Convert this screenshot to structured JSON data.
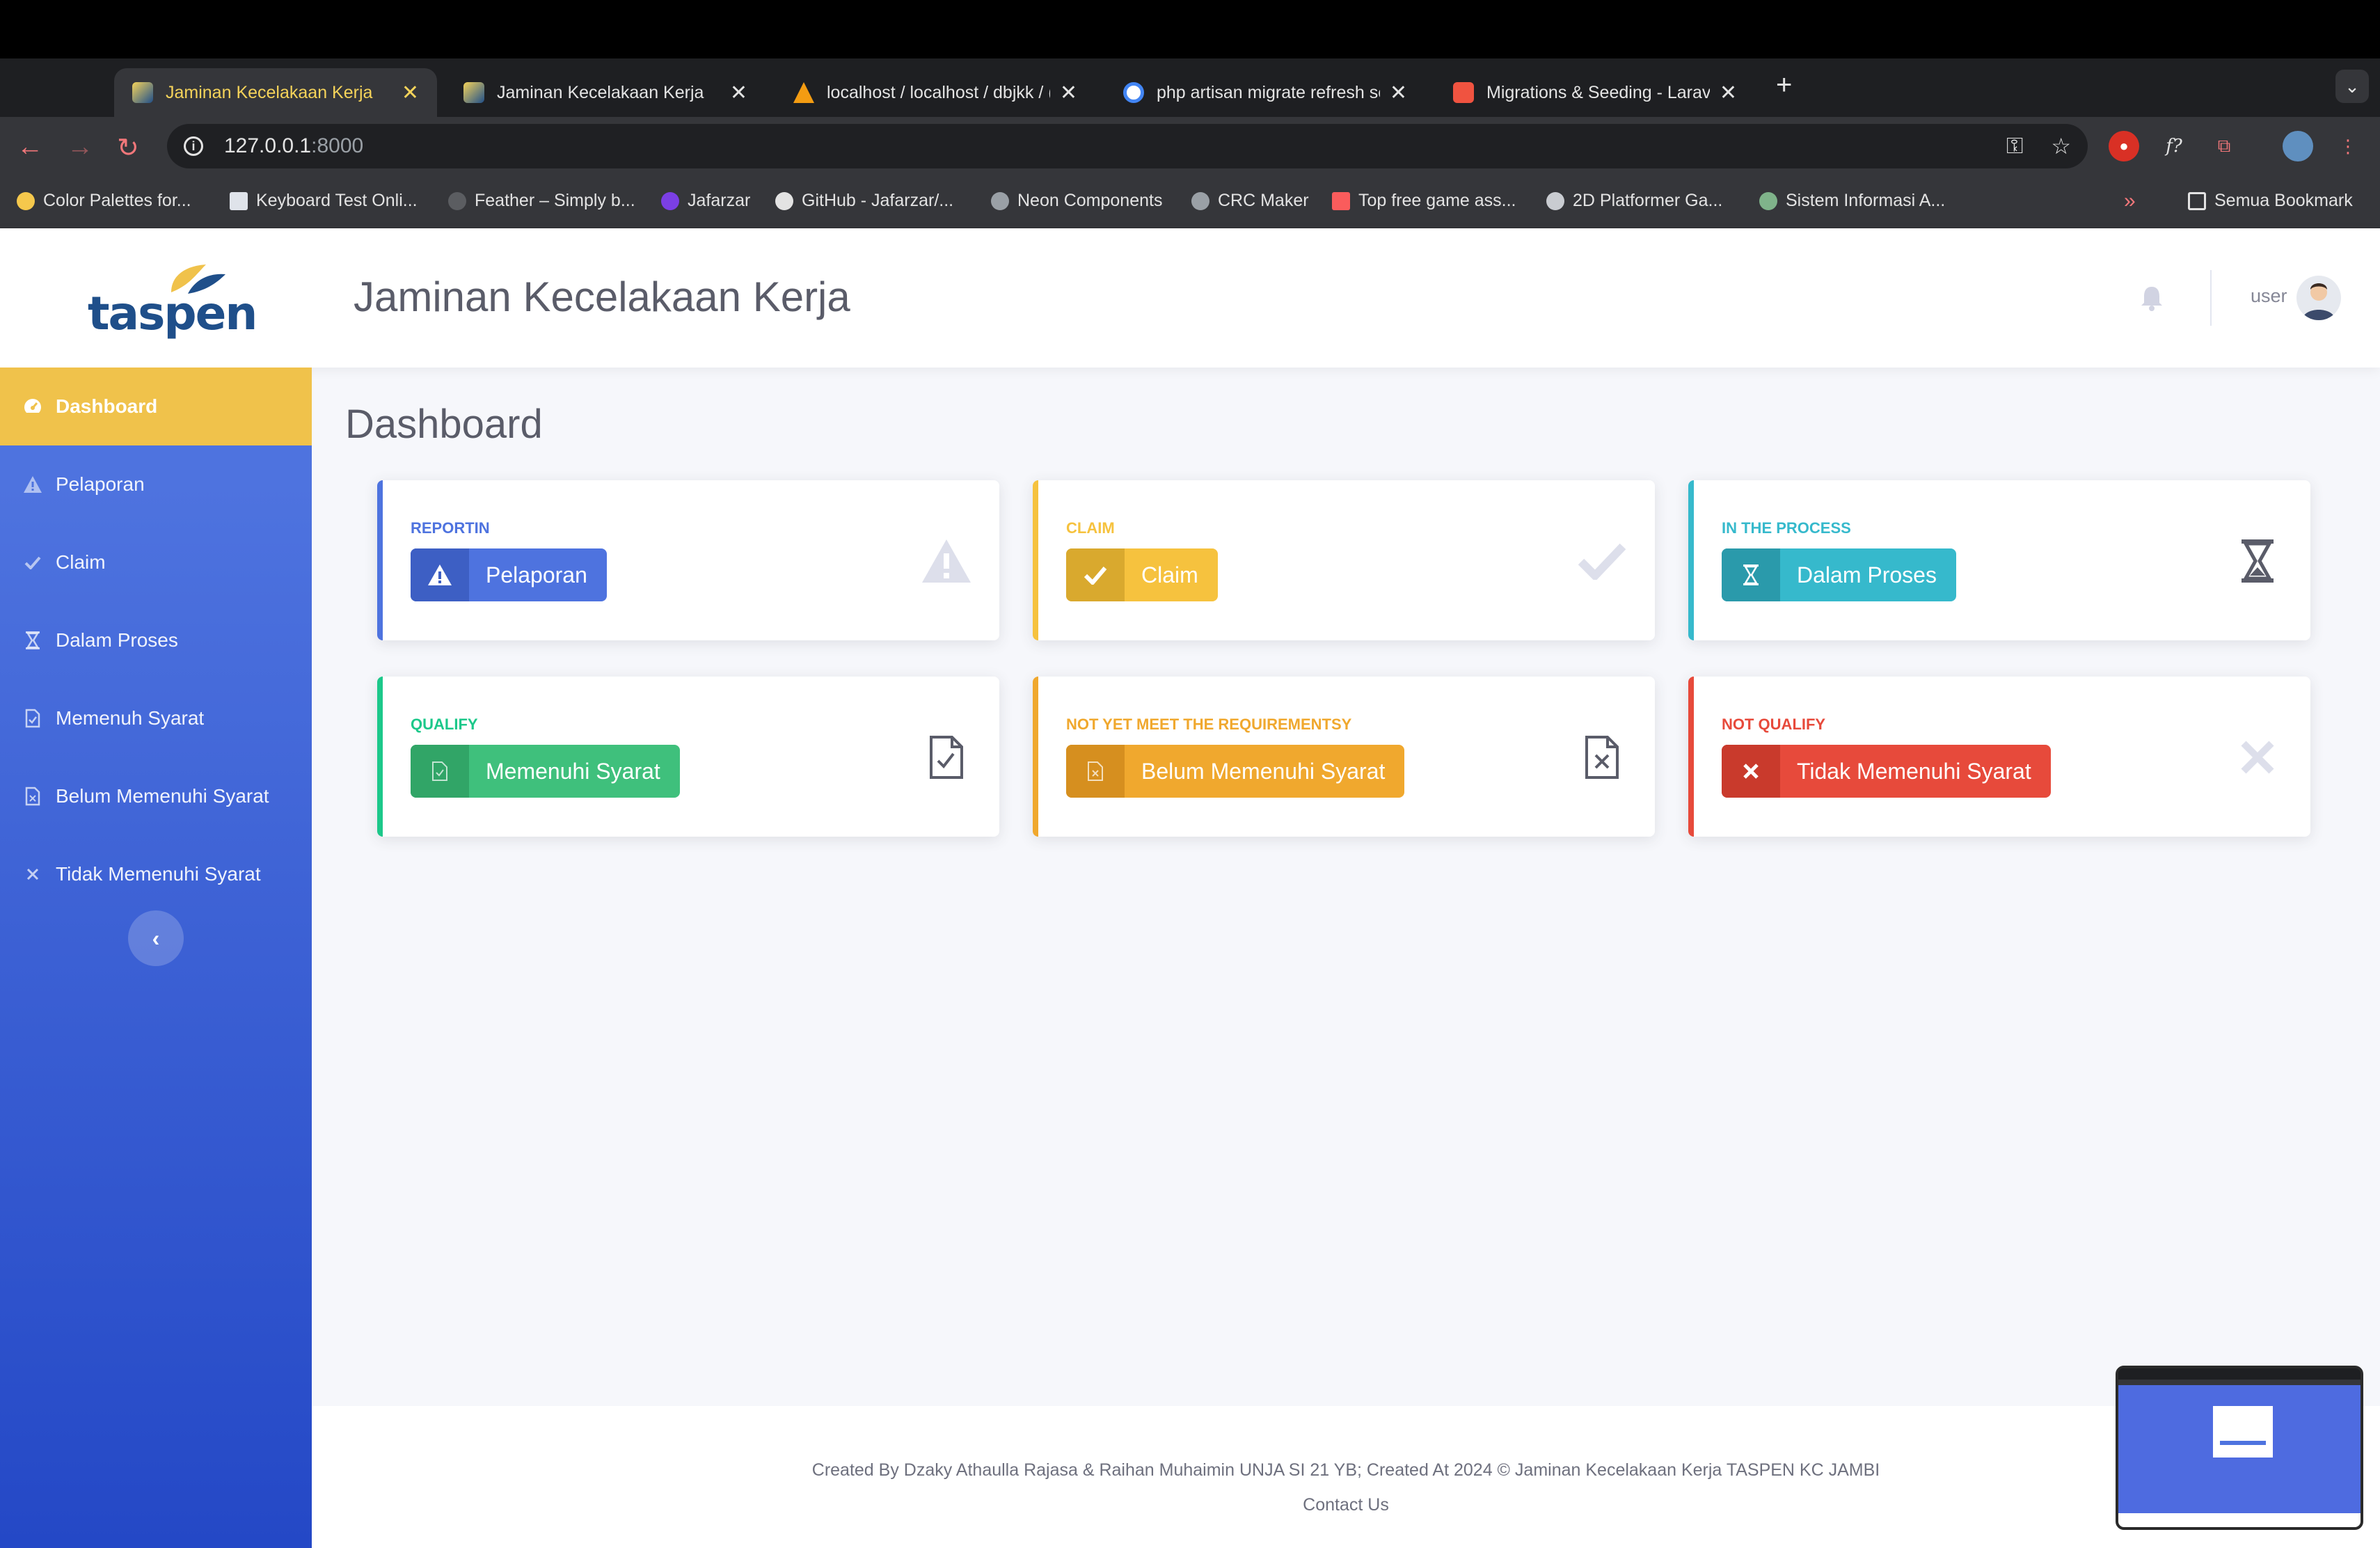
{
  "browser": {
    "tabs": [
      {
        "title": "Jaminan Kecelakaan Kerja",
        "active": true
      },
      {
        "title": "Jaminan Kecelakaan Kerja",
        "active": false
      },
      {
        "title": "localhost / localhost / dbjkk / (",
        "active": false
      },
      {
        "title": "php artisan migrate refresh se",
        "active": false
      },
      {
        "title": "Migrations & Seeding - Larave",
        "active": false
      }
    ],
    "new_tab": "+",
    "tab_menu": "⌄",
    "url_host": "127.0.0.1",
    "url_port": ":8000",
    "bookmarks": [
      "Color Palettes for...",
      "Keyboard Test Onli...",
      "Feather – Simply b...",
      "Jafarzar",
      "GitHub - Jafarzar/...",
      "Neon Components",
      "CRC Maker",
      "Top free game ass...",
      "2D Platformer Ga...",
      "Sistem Informasi A..."
    ],
    "bookmarks_more": "»",
    "all_bookmarks": "Semua Bookmark"
  },
  "app": {
    "title": "Jaminan Kecelakaan Kerja",
    "logo": "taspen",
    "user": "user",
    "page_heading": "Dashboard"
  },
  "sidebar": {
    "items": [
      {
        "label": "Dashboard",
        "icon": "dashboard-icon",
        "active": true
      },
      {
        "label": "Pelaporan",
        "icon": "warning-icon"
      },
      {
        "label": "Claim",
        "icon": "check-icon"
      },
      {
        "label": "Dalam Proses",
        "icon": "hourglass-icon"
      },
      {
        "label": "Memenuh Syarat",
        "icon": "file-check-icon"
      },
      {
        "label": "Belum Memenuhi Syarat",
        "icon": "file-icon"
      },
      {
        "label": "Tidak Memenuhi Syarat",
        "icon": "x-icon"
      }
    ],
    "toggle": "‹"
  },
  "cards": [
    {
      "label": "REPORTIN",
      "button": "Pelaporan",
      "color": "#4e73df",
      "icon": "warning-icon"
    },
    {
      "label": "CLAIM",
      "button": "Claim",
      "color": "#f6c23e",
      "icon": "check-icon"
    },
    {
      "label": "IN THE PROCESS",
      "button": "Dalam Proses",
      "color": "#36b9cc",
      "icon": "hourglass-icon"
    },
    {
      "label": "QUALIFY",
      "button": "Memenuhi Syarat",
      "color": "#1cc88a",
      "icon": "file-check-icon"
    },
    {
      "label": "NOT YET MEET THE REQUIREMENTSY",
      "button": "Belum Memenuhi Syarat",
      "color": "#f0a82e",
      "icon": "file-x-icon"
    },
    {
      "label": "NOT QUALIFY",
      "button": "Tidak Memenuhi Syarat",
      "color": "#e74a3b",
      "icon": "x-icon"
    }
  ],
  "footer": {
    "credit": "Created By Dzaky Athaulla Rajasa & Raihan Muhaimin UNJA SI 21 YB; Created At 2024 © Jaminan Kecelakaan Kerja TASPEN KC JAMBI",
    "contact": "Contact Us"
  }
}
